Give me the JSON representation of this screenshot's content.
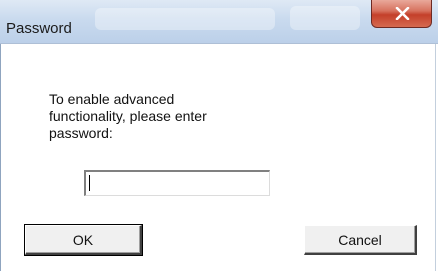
{
  "dialog": {
    "title": "Password",
    "prompt": "To enable advanced\nfunctionality, please enter\npassword:",
    "password_value": "",
    "ok_label": "OK",
    "cancel_label": "Cancel",
    "close_icon": "close-icon"
  },
  "colors": {
    "titlebar": "#c9daee",
    "close_button": "#c4402a",
    "client_bg": "#ffffff",
    "button_face": "#f0f0f0"
  }
}
